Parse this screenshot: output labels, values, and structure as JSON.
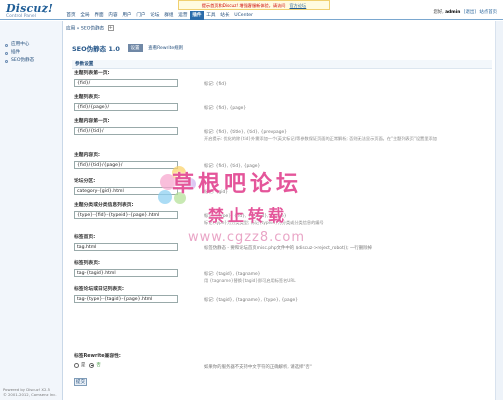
{
  "header": {
    "logo_brand": "Discuz!",
    "logo_sub": "Control Panel",
    "notice_text": "提示首页和Discuz! 增强客服新体验，请访问",
    "notice_link": "官方论坛",
    "nav": [
      "首页",
      "全局",
      "界面",
      "内容",
      "用户",
      "门户",
      "论坛",
      "群组",
      "运营",
      "插件",
      "工具",
      "站长",
      "UCenter"
    ],
    "nav_active_index": 9,
    "user_prefix": "您好,",
    "username": "admin",
    "user_links": [
      "[退出]",
      "站点首页"
    ]
  },
  "sidebar": {
    "items": [
      "应用中心",
      "插件",
      "SEO伪静态"
    ],
    "footer_line1": "Powered by Discuz! X2.5",
    "footer_line2": "© 2001-2012, Comsenz Inc."
  },
  "breadcrumb": {
    "text": "应用 » SEO伪静态"
  },
  "title": {
    "name": "SEO伪静态 1.0",
    "badge": "设置",
    "desc": "查看Rewrite规则"
  },
  "section_title": "参数设置",
  "rows": [
    {
      "label": "主题列表第一页:",
      "value": "{fid}/",
      "hint": "标记: {fid}",
      "hint2": ""
    },
    {
      "label": "主题列表页:",
      "value": "{fid}/{page}/",
      "hint": "标记: {fid}, {page}",
      "hint2": ""
    },
    {
      "label": "主题内容第一页:",
      "value": "{fid}/{tid}/",
      "hint": "标记: {fid}, {title}, {tid}, {prevpage}",
      "hint2": "开启提示: 优化的除{tid}外需添加一个(英文标记)等参数保证页面的正常解析; 否则无法显示页面。在\"主题列表页\"设置里添加"
    },
    {
      "label": "主题内容页:",
      "value": "{fid}/{tid}/{page}/",
      "hint": "标记: {fid}, {tid}, {page}",
      "hint2": ""
    },
    {
      "label": "论坛分区:",
      "value": "category-{gid}.html",
      "hint": "标记: {gid}",
      "hint2": ""
    },
    {
      "label": "主题分类或分类信息列表页:",
      "value": "{type}-{fid}-{typeid}-{page}.html",
      "hint": "标记: {type}, {fid}, {typeid}, {page}",
      "hint2": "标记{type}为分类类型; 标记{typeid}为分类或分类信息的编号"
    },
    {
      "label": "标签首页:",
      "value": "tag.html",
      "hint": "标签伪静态 - 要和论坛首页misc.php文件中的 $discuz->reject_robot(); 一行删除掉",
      "hint2": ""
    },
    {
      "label": "标签列表页:",
      "value": "tag-{tagid}.html",
      "hint": "标记: {tagid}, {tagname}",
      "hint2": "用 {tagname}替换{tagid}即可启用标签名URL"
    },
    {
      "label": "标签论坛或日记列表页:",
      "value": "tag-{type}-{tagid}-{page}.html",
      "hint": "标记: {tagid}, {tagname}, {type}, {page}",
      "hint2": ""
    }
  ],
  "rewrite_option": {
    "label": "标签Rewrite兼容性:",
    "choices": [
      "是",
      "否"
    ],
    "hint": "如果你的服务器不支持中文字符的正确解析, 请选择\"否\""
  },
  "submit_label": "提交",
  "watermark": {
    "line1": "草根吧论坛",
    "line2": "禁止转载",
    "line3": "www.cgzz8.com"
  }
}
